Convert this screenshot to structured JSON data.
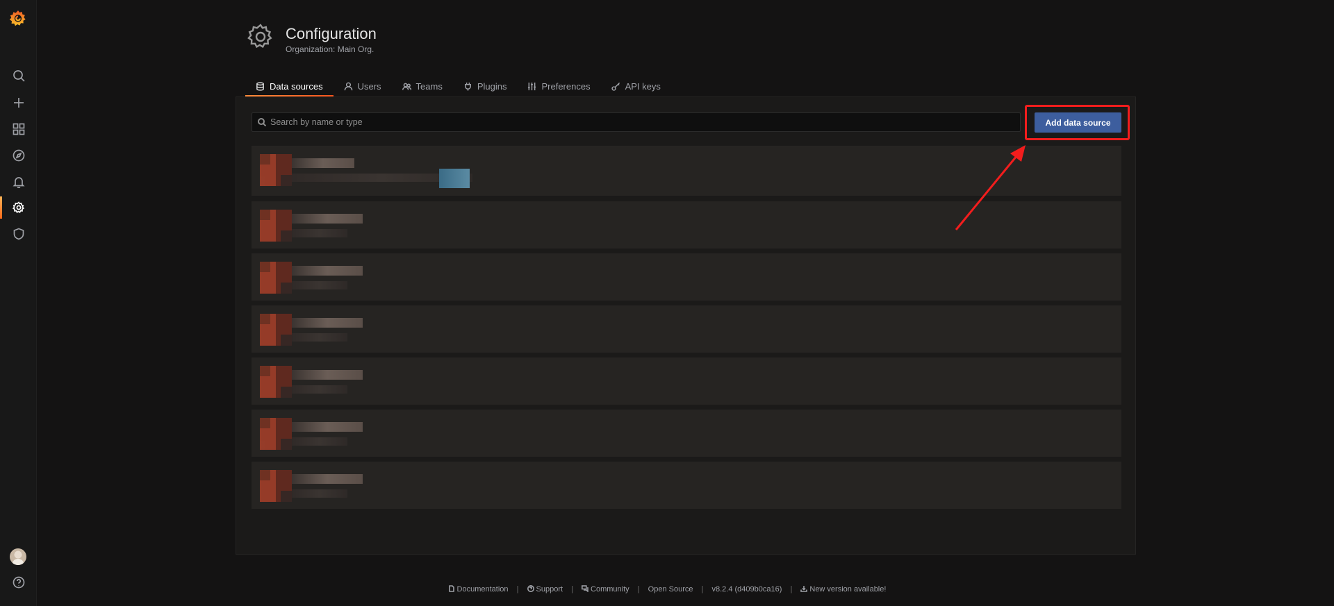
{
  "colors": {
    "accent": "#f5531c",
    "primary_button": "#3d5e9e",
    "annotation": "#f21d1d"
  },
  "sidemenu": {
    "logo": "grafana-logo-icon",
    "items": [
      {
        "name": "search-icon"
      },
      {
        "name": "plus-icon"
      },
      {
        "name": "dashboards-icon"
      },
      {
        "name": "explore-icon"
      },
      {
        "name": "alerting-bell-icon"
      },
      {
        "name": "gear-icon",
        "active": true
      },
      {
        "name": "shield-icon"
      }
    ],
    "bottom": [
      {
        "name": "avatar"
      },
      {
        "name": "help-icon"
      }
    ]
  },
  "header": {
    "title": "Configuration",
    "subtitle": "Organization: Main Org."
  },
  "tabs": [
    {
      "label": "Data sources",
      "icon": "database-icon",
      "active": true
    },
    {
      "label": "Users",
      "icon": "user-icon"
    },
    {
      "label": "Teams",
      "icon": "users-icon"
    },
    {
      "label": "Plugins",
      "icon": "plug-icon"
    },
    {
      "label": "Preferences",
      "icon": "sliders-icon"
    },
    {
      "label": "API keys",
      "icon": "key-icon"
    }
  ],
  "search": {
    "placeholder": "Search by name or type",
    "value": ""
  },
  "actions": {
    "add_label": "Add data source"
  },
  "footer": {
    "documentation": "Documentation",
    "support": "Support",
    "community": "Community",
    "open_source": "Open Source",
    "version": "v8.2.4 (d409b0ca16)",
    "new_version": "New version available!"
  }
}
